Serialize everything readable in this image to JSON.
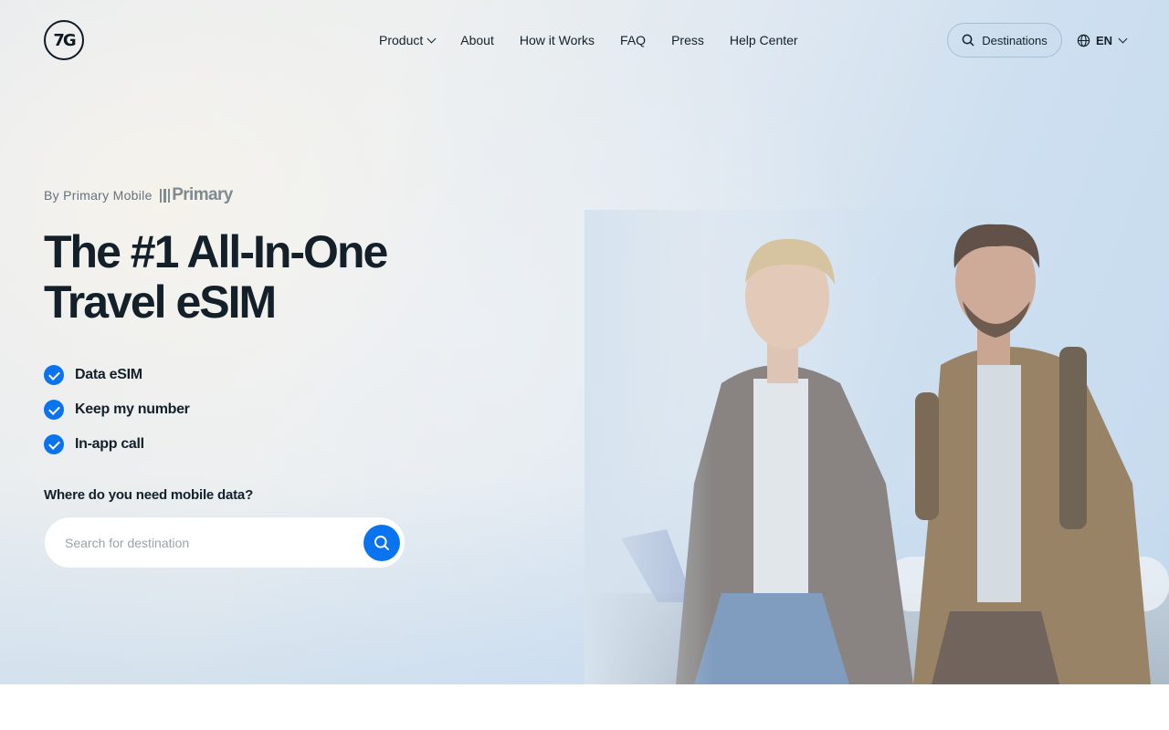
{
  "brand": {
    "logo_text": "7G"
  },
  "nav": {
    "items": [
      {
        "label": "Product",
        "has_dropdown": true
      },
      {
        "label": "About"
      },
      {
        "label": "How it Works"
      },
      {
        "label": "FAQ"
      },
      {
        "label": "Press"
      },
      {
        "label": "Help Center"
      }
    ]
  },
  "header": {
    "destinations_label": "Destinations",
    "language": "EN"
  },
  "hero": {
    "by_line": "By Primary Mobile",
    "partner_logo_text": "Primary",
    "headline_line1": "The #1 All-In-One",
    "headline_line2": "Travel eSIM",
    "features": [
      {
        "label": "Data eSIM"
      },
      {
        "label": "Keep my number"
      },
      {
        "label": "In-app call"
      }
    ],
    "search": {
      "question": "Where do you need mobile data?",
      "placeholder": "Search for destination",
      "value": ""
    }
  },
  "colors": {
    "accent": "#0a74f0",
    "text_dark": "#13202a",
    "muted": "#66727c"
  },
  "icons": {
    "search": "search-icon",
    "globe": "globe-icon",
    "check": "check-icon",
    "chevron": "chevron-down-icon"
  }
}
